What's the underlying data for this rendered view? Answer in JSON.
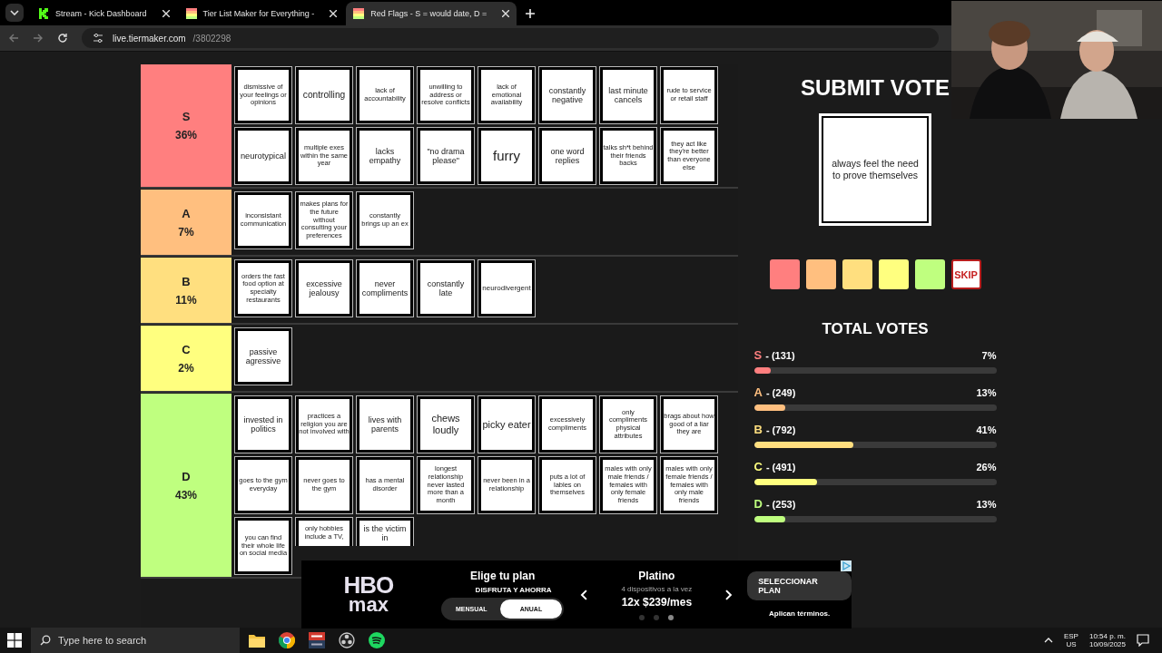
{
  "browser": {
    "tabs": [
      {
        "title": "Stream - Kick Dashboard",
        "kind": "kick",
        "selected": false
      },
      {
        "title": "Tier List Maker for Everything -",
        "kind": "tiermaker",
        "selected": false
      },
      {
        "title": "Red Flags - S = would date, D =",
        "kind": "tiermaker",
        "selected": true
      }
    ],
    "url": {
      "host": "live.tiermaker.com",
      "path": "/3802298"
    }
  },
  "tiers": [
    {
      "label": "S",
      "percent": "36%",
      "color": "#ff7f7f",
      "rows": [
        [
          "dismissive of your feelings or opinions",
          "controlling",
          "lack of accountability",
          "unwilling to address or resolve conflicts",
          "lack of emotional availability",
          "constantly negative",
          "last minute cancels",
          "rude to service or retail staff"
        ],
        [
          "neurotypical",
          "multiple exes within the same year",
          "lacks empathy",
          "\"no drama please\"",
          "furry",
          "one word replies",
          "talks sh*t behind their friends backs",
          "they act like they're better than everyone else"
        ]
      ]
    },
    {
      "label": "A",
      "percent": "7%",
      "color": "#ffbf7f",
      "rows": [
        [
          "inconsistant communication",
          "makes plans for the future without consulting your preferences",
          "constantly brings up an ex"
        ]
      ]
    },
    {
      "label": "B",
      "percent": "11%",
      "color": "#ffdf7f",
      "rows": [
        [
          "orders the fast food option at specialty restaurants",
          "excessive jealousy",
          "never compliments",
          "constantly late",
          "neurodivergent"
        ]
      ]
    },
    {
      "label": "C",
      "percent": "2%",
      "color": "#ffff7f",
      "rows": [
        [
          "passive agressive"
        ]
      ]
    },
    {
      "label": "D",
      "percent": "43%",
      "color": "#bfff7f",
      "rows": [
        [
          "invested in politics",
          "practices a religion you are not involved with",
          "lives with parents",
          "chews loudly",
          "picky eater",
          "excessively compliments",
          "only compliments physical attributes",
          "brags about how good of a liar they are"
        ],
        [
          "goes to the gym everyday",
          "never goes to the gym",
          "has a mental disorder",
          "longest relationship never lasted more than a month",
          "never been in a relationship",
          "puts a lot of lables on themselves",
          "males with only male friends / females with only female friends",
          "males with only female friends / females with only male friends"
        ],
        [
          "you can find their whole life on social media",
          "only hobbies include a TV,",
          "is the victim in"
        ]
      ]
    }
  ],
  "vote": {
    "title": "SUBMIT VOTE",
    "card": "always feel the need to prove themselves",
    "buttons": [
      {
        "kind": "color",
        "color": "#ff7f7f"
      },
      {
        "kind": "color",
        "color": "#ffbf7f"
      },
      {
        "kind": "color",
        "color": "#ffdf7f"
      },
      {
        "kind": "color",
        "color": "#ffff7f"
      },
      {
        "kind": "color",
        "color": "#bfff7f"
      },
      {
        "kind": "skip",
        "label": "SKIP"
      }
    ],
    "totals_title": "TOTAL VOTES",
    "results": [
      {
        "tier": "S",
        "count": "- (131)",
        "percent": "7%",
        "level": 0.07,
        "color": "#ff7f7f"
      },
      {
        "tier": "A",
        "count": "- (249)",
        "percent": "13%",
        "level": 0.13,
        "color": "#ffbf7f"
      },
      {
        "tier": "B",
        "count": "- (792)",
        "percent": "41%",
        "level": 0.41,
        "color": "#ffdf7f"
      },
      {
        "tier": "C",
        "count": "- (491)",
        "percent": "26%",
        "level": 0.26,
        "color": "#ffff7f"
      },
      {
        "tier": "D",
        "count": "- (253)",
        "percent": "13%",
        "level": 0.13,
        "color": "#bfff7f"
      }
    ]
  },
  "ad": {
    "logo": [
      "HBO",
      "max"
    ],
    "heading": "Elige tu plan",
    "subheading": "DISFRUTA Y AHORRA",
    "billing": [
      {
        "label": "MENSUAL",
        "selected": false
      },
      {
        "label": "ANUAL",
        "selected": true
      }
    ],
    "plan": "Platino",
    "plan_note": "4 dispositivos a la vez",
    "price": "12x $239/mes",
    "cta": "SELECCIONAR PLAN",
    "terms": "Aplican términos.",
    "dots": [
      {
        "selected": false
      },
      {
        "selected": false
      },
      {
        "selected": true
      }
    ]
  },
  "taskbar": {
    "search_placeholder": "Type here to search",
    "apps": [
      {
        "kind": "files"
      },
      {
        "kind": "chrome"
      },
      {
        "kind": "voicemeeter"
      },
      {
        "kind": "obs"
      },
      {
        "kind": "spotify"
      }
    ],
    "language": "ESP",
    "region": "US",
    "time": "10:54 p. m.",
    "date": "10/09/2025"
  }
}
